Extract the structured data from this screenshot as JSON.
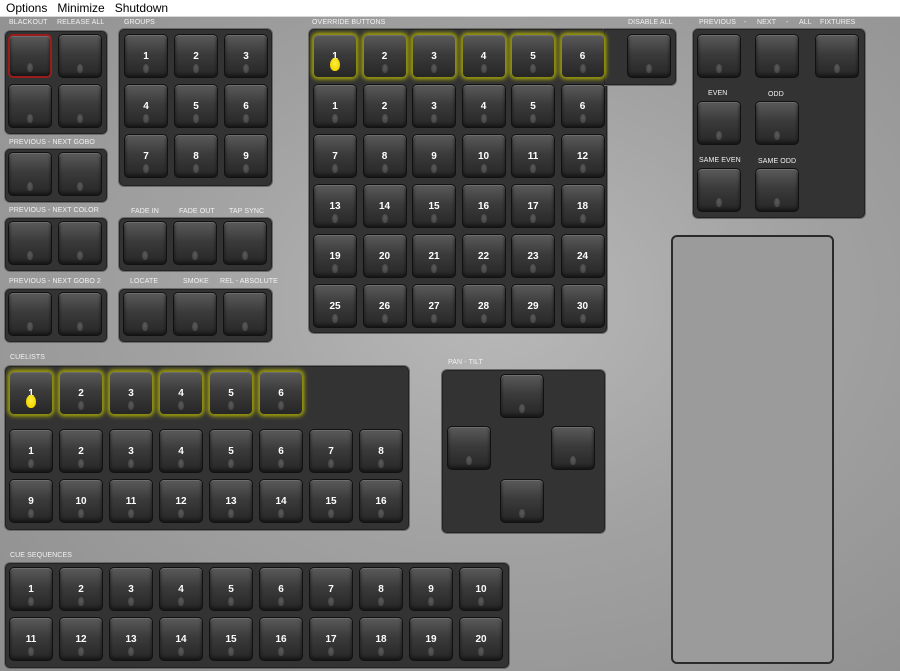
{
  "menu": [
    "Options",
    "Minimize",
    "Shutdown"
  ],
  "labels": {
    "blackout": "BLACKOUT",
    "release_all": "RELEASE ALL",
    "groups": "GROUPS",
    "override_buttons": "OVERRIDE BUTTONS",
    "disable_all": "DISABLE ALL",
    "previous": "PREVIOUS",
    "dash1": "-",
    "next": "NEXT",
    "dash2": "-",
    "all": "ALL",
    "fixtures": "FIXTURES",
    "even": "EVEN",
    "odd": "ODD",
    "same_even": "SAME EVEN",
    "same_odd": "SAME ODD",
    "prev_next_gobo": "PREVIOUS - NEXT GOBO",
    "prev_next_color": "PREVIOUS - NEXT COLOR",
    "fade_in": "FADE IN",
    "fade_out": "FADE OUT",
    "tap_sync": "TAP SYNC",
    "prev_next_gobo2": "PREVIOUS - NEXT GOBO 2",
    "locate": "LOCATE",
    "smoke": "SMOKE",
    "rel_absolute": "REL - ABSOLUTE",
    "cuelists": "CUELISTS",
    "pan_tilt": "PAN - TILT",
    "cue_sequences": "CUE SEQUENCES"
  },
  "groups": [
    "1",
    "2",
    "3",
    "4",
    "5",
    "6",
    "7",
    "8",
    "9"
  ],
  "override_top": [
    "1",
    "2",
    "3",
    "4",
    "5",
    "6"
  ],
  "override_grid": [
    "1",
    "2",
    "3",
    "4",
    "5",
    "6",
    "7",
    "8",
    "9",
    "10",
    "11",
    "12",
    "13",
    "14",
    "15",
    "16",
    "17",
    "18",
    "19",
    "20",
    "21",
    "22",
    "23",
    "24",
    "25",
    "26",
    "27",
    "28",
    "29",
    "30"
  ],
  "cuelists_top": [
    "1",
    "2",
    "3",
    "4",
    "5",
    "6"
  ],
  "cuelists_grid": [
    "1",
    "2",
    "3",
    "4",
    "5",
    "6",
    "7",
    "8",
    "9",
    "10",
    "11",
    "12",
    "13",
    "14",
    "15",
    "16"
  ],
  "cue_sequences": [
    "1",
    "2",
    "3",
    "4",
    "5",
    "6",
    "7",
    "8",
    "9",
    "10",
    "11",
    "12",
    "13",
    "14",
    "15",
    "16",
    "17",
    "18",
    "19",
    "20"
  ]
}
